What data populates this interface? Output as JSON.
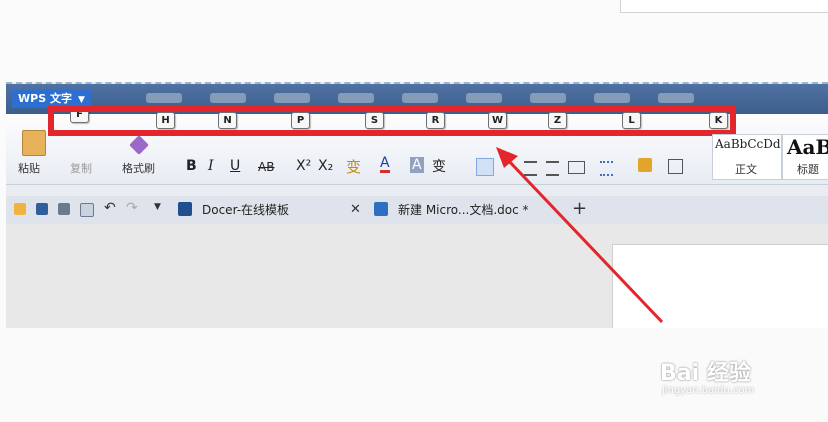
{
  "app": {
    "name": "WPS 文字"
  },
  "keytips": [
    "F",
    "H",
    "N",
    "P",
    "S",
    "R",
    "W",
    "Z",
    "L",
    "K"
  ],
  "clipboard": {
    "paste": "粘贴",
    "copy": "复制",
    "format_painter": "格式刷"
  },
  "font": {
    "bold": "B",
    "italic": "I",
    "underline": "U",
    "strike": "AB",
    "superscript": "X²",
    "subscript": "X₂",
    "color": "A",
    "highlight": "A",
    "phonetic": "变"
  },
  "styles": {
    "sample1": "AaBbCcDd",
    "label1": "正文",
    "sample2": "AaB",
    "label2": "标题"
  },
  "doc_tabs": [
    {
      "label": "Docer-在线模板"
    },
    {
      "label": "新建 Micro...文档.doc *"
    }
  ],
  "watermark": {
    "brand": "Bai 经验",
    "url": "jingyan.baidu.com"
  },
  "colors": {
    "highlight_box": "#e3252c",
    "arrow": "#e3252c",
    "titlebar": "#4a6d9c"
  }
}
